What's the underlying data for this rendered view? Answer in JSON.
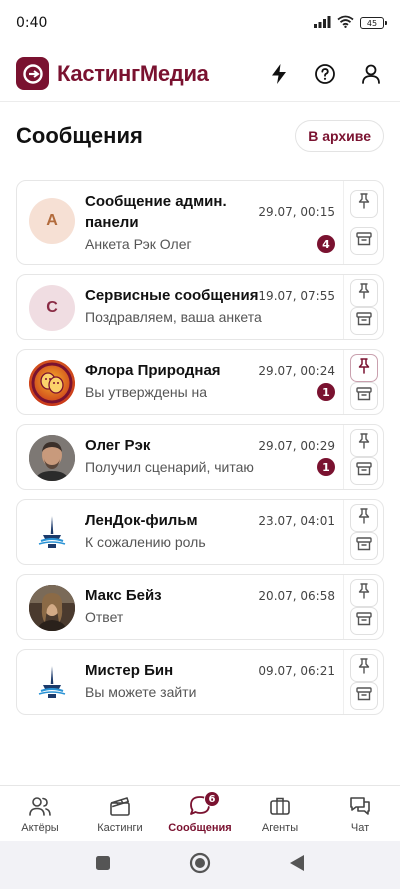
{
  "status": {
    "time": "0:40",
    "battery": "45"
  },
  "app": {
    "name": "КастингМедиа",
    "brand_color": "#7a1230"
  },
  "header": {
    "icons": [
      "bolt-icon",
      "help-icon",
      "profile-icon"
    ]
  },
  "page": {
    "title": "Сообщения",
    "archive_label": "В архиве"
  },
  "chats": [
    {
      "name": "Сообщение админ. панели",
      "preview": "Анкета Рэк Олег",
      "time": "29.07, 00:15",
      "unread": "4",
      "avatar_letter": "А",
      "pinned": false
    },
    {
      "name": "Сервисные сообщения",
      "preview": "Поздравляем, ваша анкета",
      "time": "19.07, 07:55",
      "unread": "",
      "avatar_letter": "С",
      "pinned": false
    },
    {
      "name": "Флора Природная",
      "preview": "Вы утверждены на",
      "time": "29.07, 00:24",
      "unread": "1",
      "avatar_letter": "",
      "pinned": true
    },
    {
      "name": "Олег Рэк",
      "preview": "Получил сценарий, читаю",
      "time": "29.07, 00:29",
      "unread": "1",
      "avatar_letter": "",
      "pinned": false
    },
    {
      "name": "ЛенДок-фильм",
      "preview": "К сожалению роль",
      "time": "23.07, 04:01",
      "unread": "",
      "avatar_letter": "",
      "pinned": false
    },
    {
      "name": "Макс Бейз",
      "preview": "Ответ",
      "time": "20.07, 06:58",
      "unread": "",
      "avatar_letter": "",
      "pinned": false
    },
    {
      "name": "Мистер Бин",
      "preview": "Вы можете зайти",
      "time": "09.07, 06:21",
      "unread": "",
      "avatar_letter": "",
      "pinned": false
    }
  ],
  "nav": {
    "items": [
      {
        "label": "Актёры",
        "icon": "actors-icon"
      },
      {
        "label": "Кастинги",
        "icon": "clapperboard-icon"
      },
      {
        "label": "Сообщения",
        "icon": "messages-icon",
        "badge": "6"
      },
      {
        "label": "Агенты",
        "icon": "briefcase-icon"
      },
      {
        "label": "Чат",
        "icon": "chat-icon"
      }
    ]
  }
}
